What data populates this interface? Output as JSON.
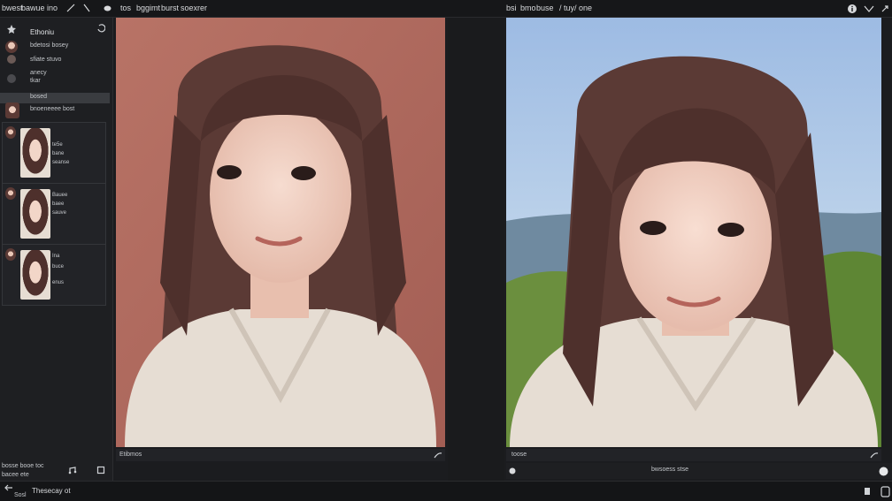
{
  "topbar": {
    "left_menu": [
      "bwest",
      "bawue ino"
    ],
    "left_tabs": [
      "tos",
      "bggimt",
      "burst",
      "soexrer"
    ],
    "right_menu": [
      "bsi",
      "bmo",
      "buse",
      "/ tuy/ one"
    ]
  },
  "sidebar": {
    "header": "Ethoniu",
    "rows": [
      {
        "label": "bdetosi bosey"
      },
      {
        "label": "sfiate  stuvo"
      },
      {
        "label": "anecy"
      },
      {
        "label": "tkar"
      },
      {
        "label": "bosed"
      },
      {
        "label": "bnoeneeee bost"
      }
    ],
    "cards": [
      {
        "lines": [
          "te5e",
          "bane",
          "seanse"
        ]
      },
      {
        "lines": [
          "Bauee",
          "baee",
          "sauve"
        ]
      },
      {
        "lines": [
          "Ina",
          "buce",
          "enus"
        ]
      }
    ],
    "footer": {
      "label1": "bosse booe toc",
      "label2": "bacee ete"
    }
  },
  "left_canvas": {
    "status": "Etibmos"
  },
  "right_canvas": {
    "status": "toose",
    "center_label": "bwsoess stse"
  },
  "bottom": {
    "item1": "Sosl",
    "item2": "Thesecay ot"
  },
  "colors": {
    "bg": "#1a1b1d",
    "left_backdrop": "#b87366",
    "sky": "#a9c4e6",
    "hair": "#5b3a35",
    "sweater": "#e6ddd3"
  }
}
